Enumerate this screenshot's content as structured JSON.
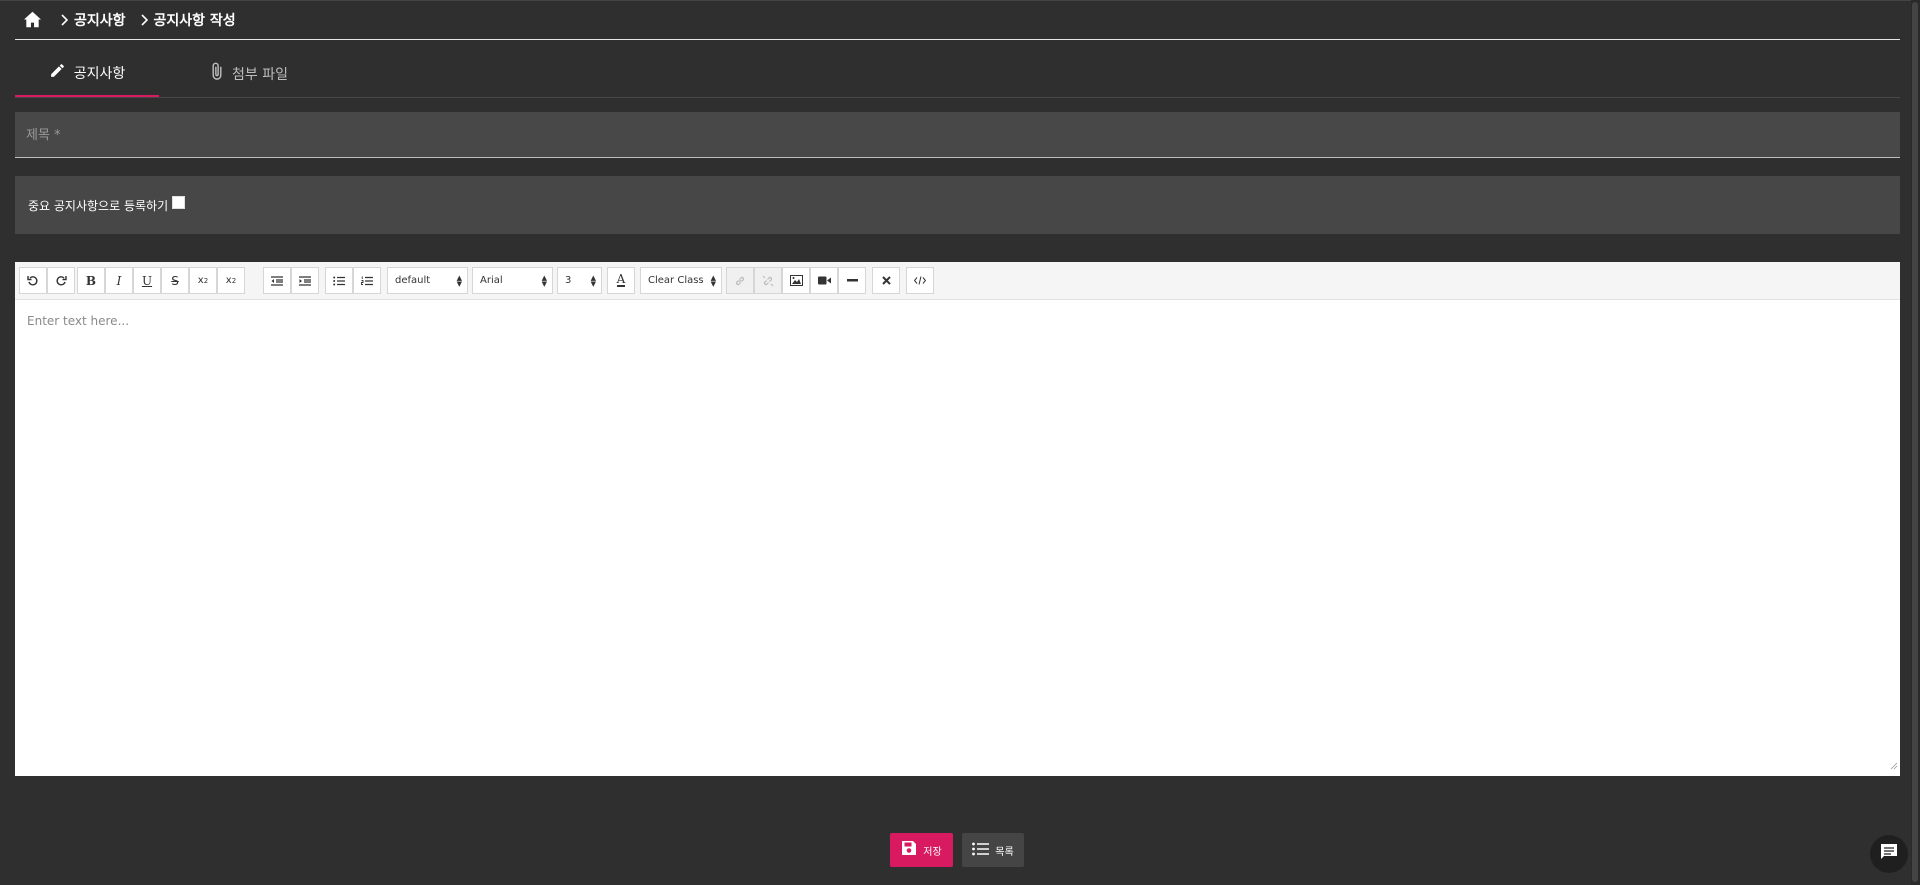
{
  "breadcrumb": {
    "items": [
      {
        "label": "공지사항"
      },
      {
        "label": "공지사항 작성"
      }
    ]
  },
  "tabs": [
    {
      "label": "공지사항",
      "icon": "pencil-icon",
      "active": true
    },
    {
      "label": "첨부 파일",
      "icon": "paperclip-icon",
      "active": false
    }
  ],
  "form": {
    "title_placeholder": "제목 *",
    "title_value": "",
    "important_label": "중요 공지사항으로 등록하기",
    "important_checked": false
  },
  "editor": {
    "placeholder": "Enter text here...",
    "toolbar": {
      "paragraph_style": "default",
      "font_family": "Arial",
      "font_size": "3",
      "clear_class": "Clear Class"
    }
  },
  "actions": {
    "save_label": "저장",
    "list_label": "목록"
  },
  "colors": {
    "accent": "#d81b60",
    "background": "#2f2f2f"
  }
}
